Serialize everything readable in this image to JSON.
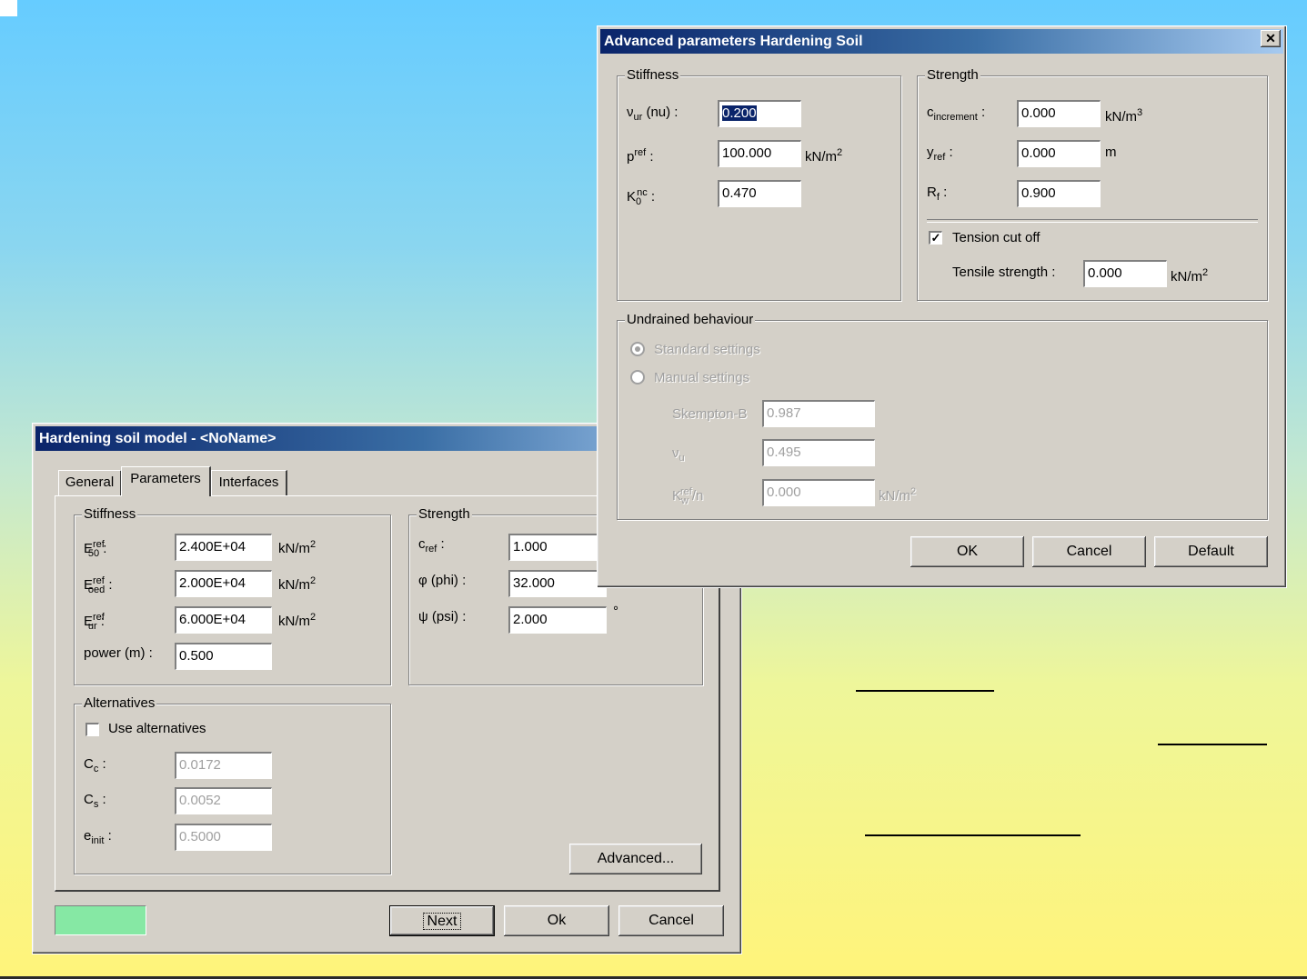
{
  "main": {
    "title": "Hardening soil model - <NoName>",
    "tabs": [
      {
        "label": "General"
      },
      {
        "label": "Parameters"
      },
      {
        "label": "Interfaces"
      }
    ],
    "stiffness": {
      "legend": "Stiffness",
      "e50_value": "2.400E+04",
      "eoed_value": "2.000E+04",
      "eur_value": "6.000E+04",
      "power_label": "power (m) :",
      "power_value": "0.500",
      "unit": "kN/m",
      "unit_exp": "2"
    },
    "strength": {
      "legend": "Strength",
      "cref_value": "1.000",
      "phi_label": "φ (phi) :",
      "phi_value": "32.000",
      "psi_label": "ψ (psi) :",
      "psi_value": "2.000",
      "deg": "°"
    },
    "alternatives": {
      "legend": "Alternatives",
      "use_label": "Use alternatives",
      "use_checked": false,
      "cc_value": "0.0172",
      "cs_value": "0.0052",
      "einit_value": "0.5000"
    },
    "buttons": {
      "advanced": "Advanced...",
      "next": "Next",
      "ok": "Ok",
      "cancel": "Cancel"
    },
    "status_color": "#86e8a4"
  },
  "advanced": {
    "title": "Advanced parameters Hardening Soil",
    "close": "✕",
    "stiffness": {
      "legend": "Stiffness",
      "nu_paren": "(nu) :",
      "nu_value": "0.200",
      "pref_value": "100.000",
      "k0_value": "0.470",
      "unit": "kN/m",
      "unit_exp": "2"
    },
    "strength": {
      "legend": "Strength",
      "cinc_value": "0.000",
      "cinc_unit": "kN/m",
      "cinc_exp": "3",
      "yref_value": "0.000",
      "yref_unit": "m",
      "rf_value": "0.900",
      "tension_label": "Tension cut off",
      "tension_checked": true,
      "tensile_label": "Tensile strength :",
      "tensile_value": "0.000",
      "tensile_unit": "kN/m",
      "tensile_exp": "2"
    },
    "undrained": {
      "legend": "Undrained behaviour",
      "standard_label": "Standard settings",
      "manual_label": "Manual settings",
      "skempton_label": "Skempton-B",
      "skempton_value": "0.987",
      "nuu_value": "0.495",
      "kw_value": "0.000",
      "kw_unit": "kN/m",
      "kw_exp": "2"
    },
    "buttons": {
      "ok": "OK",
      "cancel": "Cancel",
      "default": "Default"
    }
  }
}
